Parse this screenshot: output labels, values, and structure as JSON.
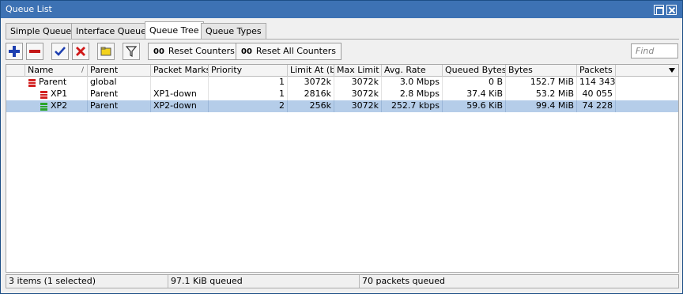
{
  "window": {
    "title": "Queue List"
  },
  "tabs": [
    {
      "label": "Simple Queues",
      "active": false
    },
    {
      "label": "Interface Queues",
      "active": false
    },
    {
      "label": "Queue Tree",
      "active": true
    },
    {
      "label": "Queue Types",
      "active": false
    }
  ],
  "toolbar": {
    "reset_counters": "Reset Counters",
    "reset_all_counters": "Reset All Counters",
    "counter_icon": "00",
    "find_placeholder": "Find",
    "icons": [
      "add-icon",
      "remove-icon",
      "enable-icon",
      "disable-icon",
      "comment-icon",
      "filter-icon"
    ]
  },
  "table": {
    "columns": [
      "Name",
      "Parent",
      "Packet Marks",
      "Priority",
      "Limit At (b...",
      "Max Limit ...",
      "Avg. Rate",
      "Queued Bytes",
      "Bytes",
      "Packets"
    ],
    "sort_indicator": "/",
    "rows": [
      {
        "name": "Parent",
        "parent": "global",
        "packet_marks": "",
        "priority": "1",
        "limit_at": "3072k",
        "max_limit": "3072k",
        "avg_rate": "3.0 Mbps",
        "queued_bytes": "0 B",
        "bytes": "152.7 MiB",
        "packets": "114 343",
        "icon_color": "#d22020",
        "indent": 0,
        "selected": false
      },
      {
        "name": "XP1",
        "parent": "Parent",
        "packet_marks": "XP1-down",
        "priority": "1",
        "limit_at": "2816k",
        "max_limit": "3072k",
        "avg_rate": "2.8 Mbps",
        "queued_bytes": "37.4 KiB",
        "bytes": "53.2 MiB",
        "packets": "40 055",
        "icon_color": "#d22020",
        "indent": 1,
        "selected": false
      },
      {
        "name": "XP2",
        "parent": "Parent",
        "packet_marks": "XP2-down",
        "priority": "2",
        "limit_at": "256k",
        "max_limit": "3072k",
        "avg_rate": "252.7 kbps",
        "queued_bytes": "59.6 KiB",
        "bytes": "99.4 MiB",
        "packets": "74 228",
        "icon_color": "#2aa52a",
        "indent": 1,
        "selected": true
      }
    ]
  },
  "status": {
    "items": "3 items (1 selected)",
    "queued": "97.1 KiB queued",
    "packets_queued": "70 packets queued"
  }
}
